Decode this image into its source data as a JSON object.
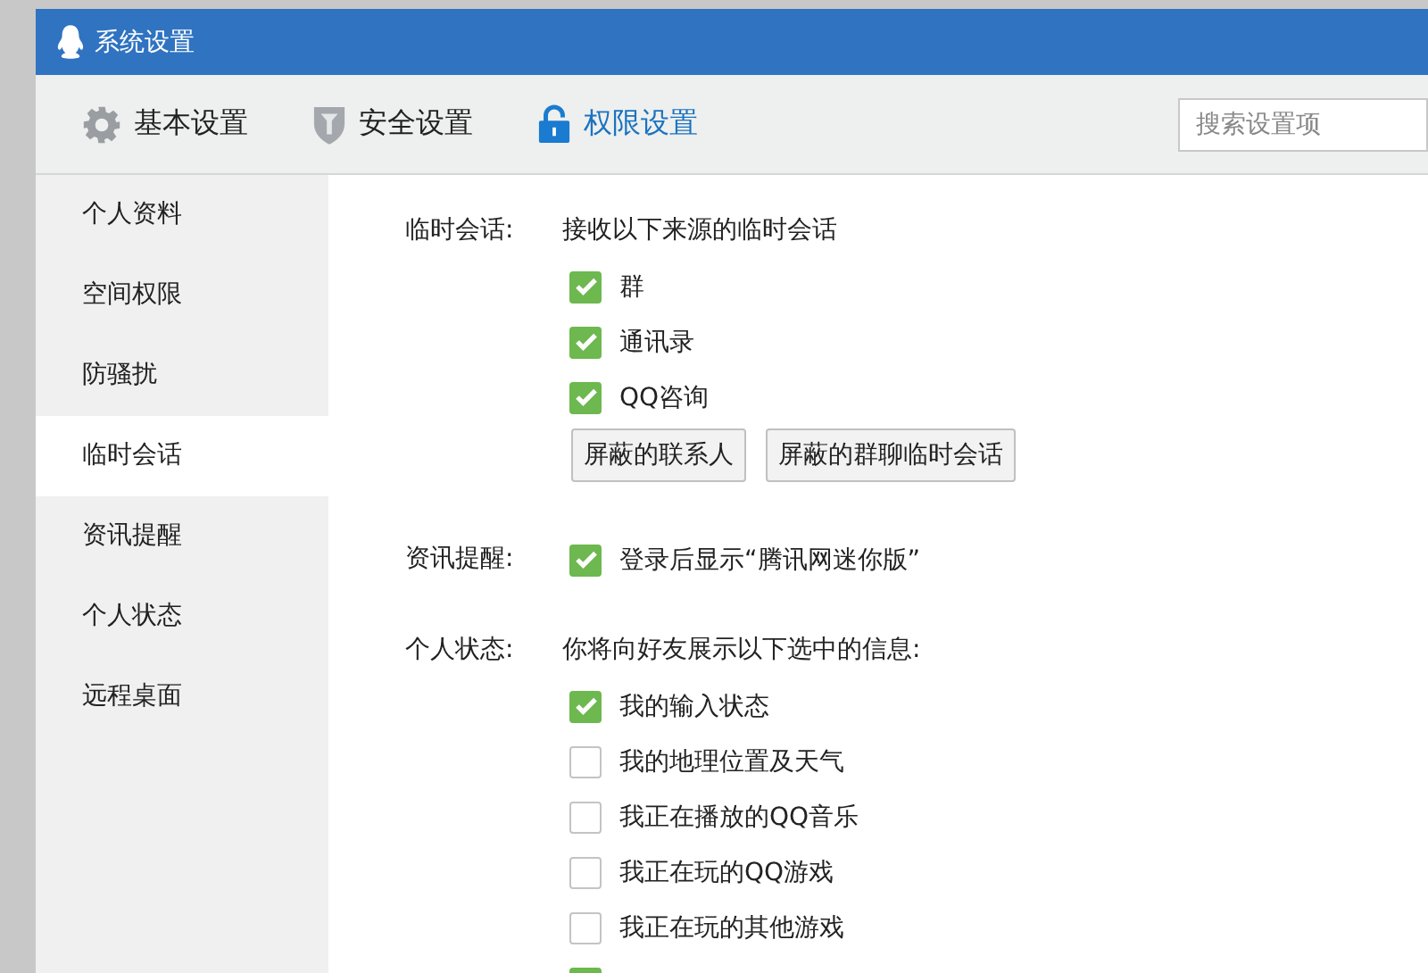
{
  "window": {
    "title": "系统设置"
  },
  "tabs": [
    {
      "label": "基本设置",
      "kind": "gear",
      "selected": false
    },
    {
      "label": "安全设置",
      "kind": "shield",
      "selected": false
    },
    {
      "label": "权限设置",
      "kind": "lock",
      "selected": true
    }
  ],
  "search": {
    "placeholder": "搜索设置项"
  },
  "sidebar": {
    "items": [
      {
        "label": "个人资料",
        "selected": false
      },
      {
        "label": "空间权限",
        "selected": false
      },
      {
        "label": "防骚扰",
        "selected": false
      },
      {
        "label": "临时会话",
        "selected": true
      },
      {
        "label": "资讯提醒",
        "selected": false
      },
      {
        "label": "个人状态",
        "selected": false
      },
      {
        "label": "远程桌面",
        "selected": false
      }
    ]
  },
  "sections": [
    {
      "label": "临时会话:",
      "intro": "接收以下来源的临时会话",
      "options": [
        {
          "label": "群",
          "checked": true
        },
        {
          "label": "通讯录",
          "checked": true
        },
        {
          "label": "QQ咨询",
          "checked": true
        }
      ],
      "buttons": [
        "屏蔽的联系人",
        "屏蔽的群聊临时会话"
      ]
    },
    {
      "label": "资讯提醒:",
      "options": [
        {
          "label": "登录后显示“腾讯网迷你版”",
          "checked": true
        }
      ]
    },
    {
      "label": "个人状态:",
      "intro": "你将向好友展示以下选中的信息:",
      "options": [
        {
          "label": "我的输入状态",
          "checked": true
        },
        {
          "label": "我的地理位置及天气",
          "checked": false
        },
        {
          "label": "我正在播放的QQ音乐",
          "checked": false
        },
        {
          "label": "我正在玩的QQ游戏",
          "checked": false
        },
        {
          "label": "我正在玩的其他游戏",
          "checked": false
        },
        {
          "checked": true
        }
      ]
    }
  ]
}
